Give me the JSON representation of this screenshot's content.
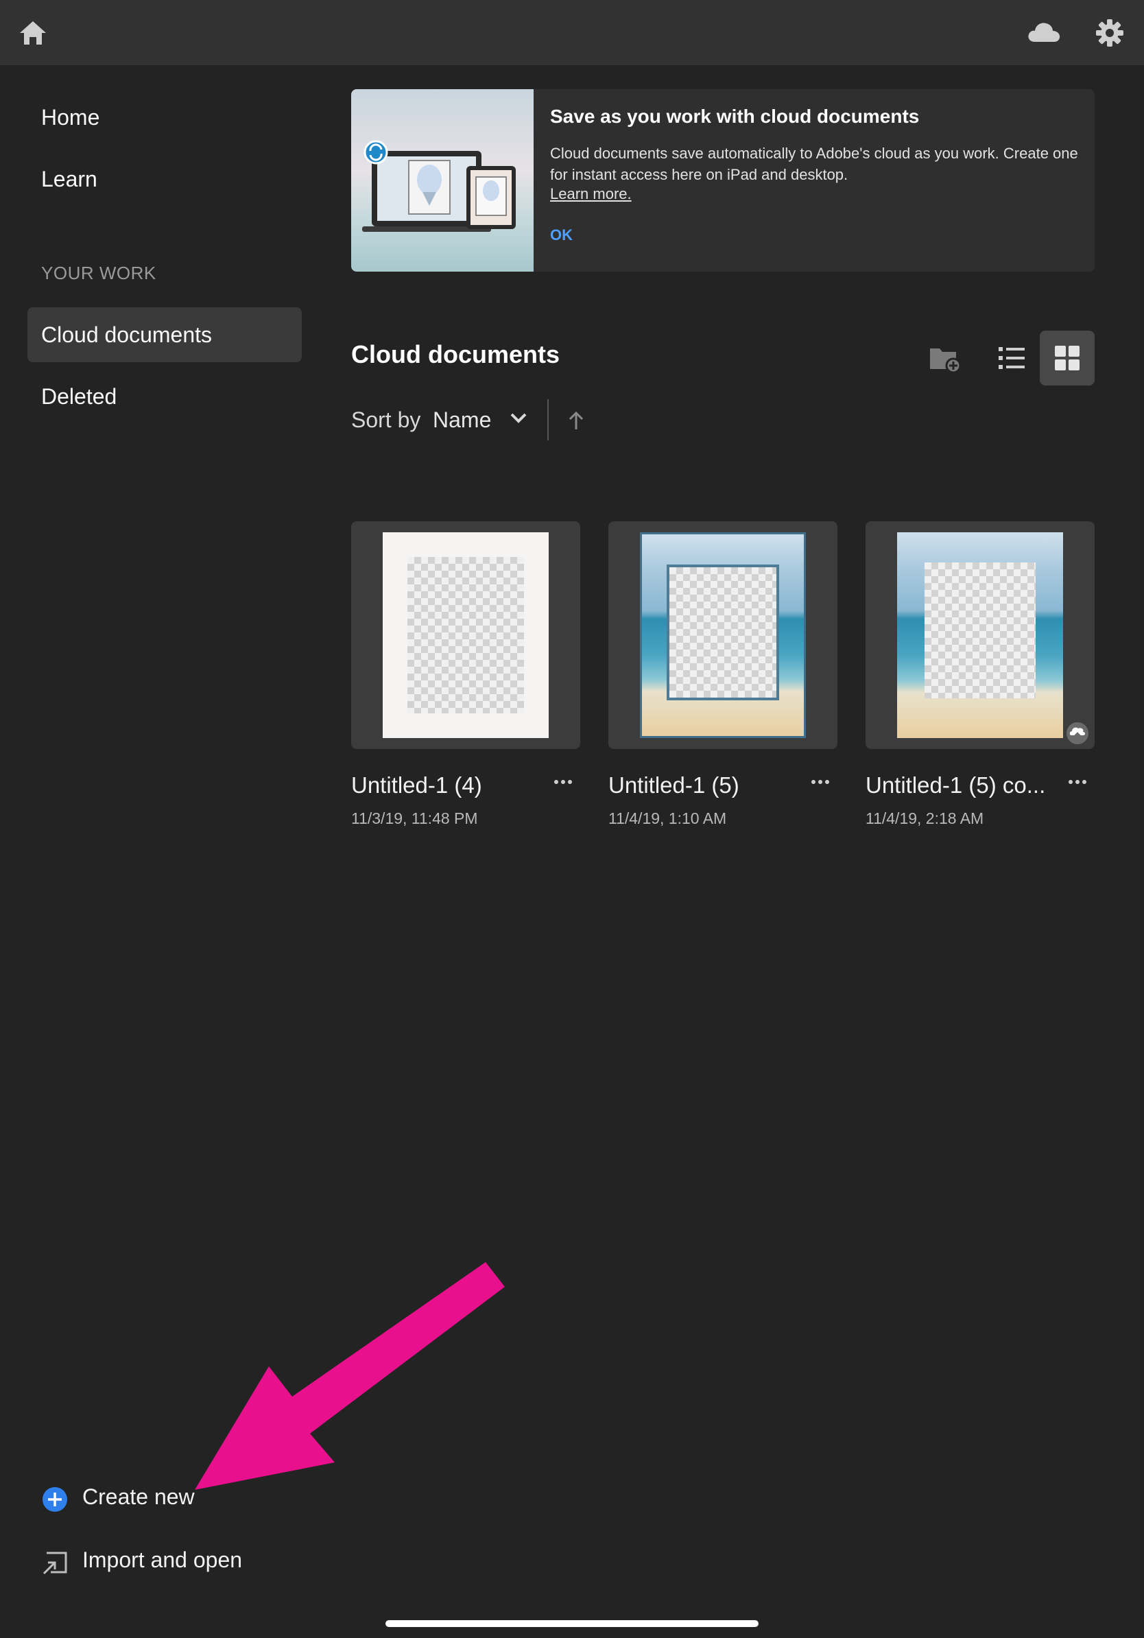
{
  "topbar": {
    "home_icon": "home-icon",
    "cloud_icon": "cloud-icon",
    "settings_icon": "gear-icon"
  },
  "sidebar": {
    "items": [
      {
        "label": "Home"
      },
      {
        "label": "Learn"
      }
    ],
    "section_label": "YOUR WORK",
    "work_items": [
      {
        "label": "Cloud documents",
        "selected": true
      },
      {
        "label": "Deleted",
        "selected": false
      }
    ],
    "create_new": "Create new",
    "import_open": "Import and open"
  },
  "banner": {
    "title": "Save as you work with cloud documents",
    "body": "Cloud documents save automatically to Adobe's cloud as you work. Create one for instant access here on iPad and desktop.",
    "link": "Learn more.",
    "ok": "OK"
  },
  "main": {
    "title": "Cloud documents",
    "sort_label": "Sort by",
    "sort_value": "Name",
    "view_buttons": [
      "new-folder-icon",
      "list-view-icon",
      "grid-view-icon"
    ],
    "active_view": "grid"
  },
  "documents": [
    {
      "name": "Untitled-1 (4)",
      "date": "11/3/19, 11:48 PM"
    },
    {
      "name": "Untitled-1 (5)",
      "date": "11/4/19, 1:10 AM"
    },
    {
      "name": "Untitled-1 (5) co...",
      "date": "11/4/19, 2:18 AM"
    }
  ],
  "colors": {
    "background": "#232323",
    "topbar": "#323232",
    "accent": "#4ea0ff",
    "annotation_arrow": "#e8108c"
  }
}
